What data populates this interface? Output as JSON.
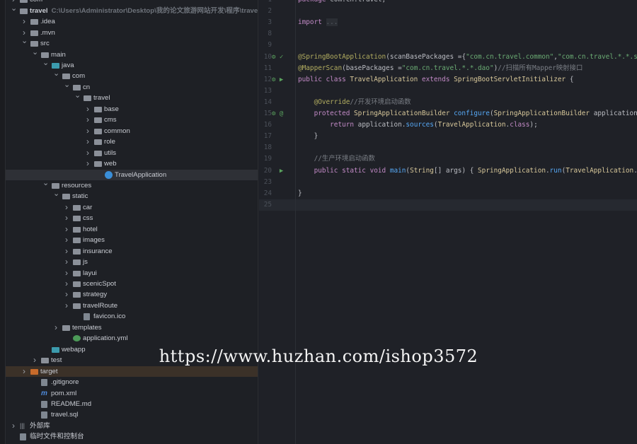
{
  "tree": [
    {
      "label": "com",
      "level": 0,
      "arrow": "right",
      "icon": "module"
    },
    {
      "label": "travel",
      "path": "C:\\Users\\Administrator\\Desktop\\我的论文旅游网站开发\\程序\\travel",
      "level": 0,
      "arrow": "down",
      "icon": "folder",
      "bold": true
    },
    {
      "label": ".idea",
      "level": 1,
      "arrow": "right",
      "icon": "folder"
    },
    {
      "label": ".mvn",
      "level": 1,
      "arrow": "right",
      "icon": "folder"
    },
    {
      "label": "src",
      "level": 1,
      "arrow": "down",
      "icon": "folder"
    },
    {
      "label": "main",
      "level": 2,
      "arrow": "down",
      "icon": "folder"
    },
    {
      "label": "java",
      "level": 3,
      "arrow": "down",
      "icon": "java"
    },
    {
      "label": "com",
      "level": 4,
      "arrow": "down",
      "icon": "package"
    },
    {
      "label": "cn",
      "level": 5,
      "arrow": "down",
      "icon": "package"
    },
    {
      "label": "travel",
      "level": 6,
      "arrow": "down",
      "icon": "package"
    },
    {
      "label": "base",
      "level": 7,
      "arrow": "right",
      "icon": "package"
    },
    {
      "label": "cms",
      "level": 7,
      "arrow": "right",
      "icon": "package"
    },
    {
      "label": "common",
      "level": 7,
      "arrow": "right",
      "icon": "package"
    },
    {
      "label": "role",
      "level": 7,
      "arrow": "right",
      "icon": "package"
    },
    {
      "label": "utils",
      "level": 7,
      "arrow": "right",
      "icon": "package"
    },
    {
      "label": "web",
      "level": 7,
      "arrow": "right",
      "icon": "package"
    },
    {
      "label": "TravelApplication",
      "level": 8,
      "icon": "class",
      "selected": true
    },
    {
      "label": "resources",
      "level": 3,
      "arrow": "down",
      "icon": "folder"
    },
    {
      "label": "static",
      "level": 4,
      "arrow": "down",
      "icon": "folder"
    },
    {
      "label": "car",
      "level": 5,
      "arrow": "right",
      "icon": "folder"
    },
    {
      "label": "css",
      "level": 5,
      "arrow": "right",
      "icon": "folder"
    },
    {
      "label": "hotel",
      "level": 5,
      "arrow": "right",
      "icon": "folder"
    },
    {
      "label": "images",
      "level": 5,
      "arrow": "right",
      "icon": "folder"
    },
    {
      "label": "insurance",
      "level": 5,
      "arrow": "right",
      "icon": "folder"
    },
    {
      "label": "js",
      "level": 5,
      "arrow": "right",
      "icon": "folder"
    },
    {
      "label": "layui",
      "level": 5,
      "arrow": "right",
      "icon": "folder"
    },
    {
      "label": "scenicSpot",
      "level": 5,
      "arrow": "right",
      "icon": "folder"
    },
    {
      "label": "strategy",
      "level": 5,
      "arrow": "right",
      "icon": "folder"
    },
    {
      "label": "travelRoute",
      "level": 5,
      "arrow": "right",
      "icon": "folder"
    },
    {
      "label": "favicon.ico",
      "level": 6,
      "icon": "file"
    },
    {
      "label": "templates",
      "level": 4,
      "arrow": "right",
      "icon": "folder"
    },
    {
      "label": "application.yml",
      "level": 5,
      "icon": "yml"
    },
    {
      "label": "webapp",
      "level": 3,
      "icon": "java"
    },
    {
      "label": "test",
      "level": 2,
      "arrow": "right",
      "icon": "folder"
    },
    {
      "label": "target",
      "level": 1,
      "arrow": "right",
      "icon": "orange",
      "target": true
    },
    {
      "label": ".gitignore",
      "level": 2,
      "icon": "file"
    },
    {
      "label": "pom.xml",
      "level": 2,
      "icon": "mvn"
    },
    {
      "label": "README.md",
      "level": 2,
      "icon": "file"
    },
    {
      "label": "travel.sql",
      "level": 2,
      "icon": "file"
    },
    {
      "label": "外部库",
      "level": 0,
      "arrow": "right",
      "icon": "lib"
    },
    {
      "label": "临时文件和控制台",
      "level": 0,
      "icon": "file"
    }
  ],
  "editor": {
    "lines": [
      {
        "n": "1",
        "t": [
          [
            "kw",
            "package "
          ],
          [
            "pl",
            "com.cn.travel;"
          ]
        ]
      },
      {
        "n": "2",
        "t": []
      },
      {
        "n": "3",
        "t": [
          [
            "kw",
            "import "
          ],
          [
            "fold",
            "..."
          ]
        ]
      },
      {
        "n": "8",
        "t": []
      },
      {
        "n": "9",
        "t": []
      },
      {
        "n": "10",
        "g": "⚙ ✓",
        "t": [
          [
            "an",
            "@SpringBootApplication"
          ],
          [
            "pl",
            "("
          ],
          [
            "pl",
            "scanBasePackages ="
          ],
          [
            "pl",
            "{"
          ],
          [
            "st",
            "\"com.cn.travel.common\""
          ],
          [
            "pl",
            ","
          ],
          [
            "st",
            "\"com.cn.travel.*.*.se"
          ]
        ]
      },
      {
        "n": "11",
        "t": [
          [
            "an",
            "@MapperScan"
          ],
          [
            "pl",
            "(basePackages ="
          ],
          [
            "st",
            "\"com.cn.travel.*.*.dao\""
          ],
          [
            "pl",
            ")"
          ],
          [
            "cm",
            "//扫描所有Mapper映射接口"
          ]
        ]
      },
      {
        "n": "12",
        "g": "⚙ ▶",
        "t": [
          [
            "kw",
            "public class "
          ],
          [
            "cl",
            "TravelApplication "
          ],
          [
            "kw",
            "extends "
          ],
          [
            "cl",
            "SpringBootServletInitializer "
          ],
          [
            "pl",
            "{"
          ]
        ]
      },
      {
        "n": "13",
        "t": []
      },
      {
        "n": "14",
        "t": [
          [
            "pl",
            "    "
          ],
          [
            "an",
            "@Override"
          ],
          [
            "cm",
            "//开发环境启动函数"
          ]
        ]
      },
      {
        "n": "15",
        "g": "⚙ @",
        "t": [
          [
            "pl",
            "    "
          ],
          [
            "kw",
            "protected "
          ],
          [
            "cl",
            "SpringApplicationBuilder "
          ],
          [
            "fn",
            "configure"
          ],
          [
            "pl",
            "("
          ],
          [
            "cl",
            "SpringApplicationBuilder "
          ],
          [
            "pl",
            "application)"
          ]
        ]
      },
      {
        "n": "16",
        "t": [
          [
            "pl",
            "        "
          ],
          [
            "kw",
            "return "
          ],
          [
            "pl",
            "application."
          ],
          [
            "fn",
            "sources"
          ],
          [
            "pl",
            "("
          ],
          [
            "cl",
            "TravelApplication"
          ],
          [
            "pl",
            "."
          ],
          [
            "kw",
            "class"
          ],
          [
            "pl",
            ");"
          ]
        ]
      },
      {
        "n": "17",
        "t": [
          [
            "pl",
            "    }"
          ]
        ]
      },
      {
        "n": "18",
        "t": []
      },
      {
        "n": "19",
        "t": [
          [
            "pl",
            "    "
          ],
          [
            "cm",
            "//生产环境启动函数"
          ]
        ]
      },
      {
        "n": "20",
        "g": "  ▶",
        "t": [
          [
            "pl",
            "    "
          ],
          [
            "kw",
            "public static void "
          ],
          [
            "fn",
            "main"
          ],
          [
            "pl",
            "("
          ],
          [
            "cl",
            "String"
          ],
          [
            "pl",
            "[] "
          ],
          [
            "pl",
            "args) { "
          ],
          [
            "cl",
            "SpringApplication"
          ],
          [
            "pl",
            "."
          ],
          [
            "fn",
            "run"
          ],
          [
            "pl",
            "("
          ],
          [
            "cl",
            "TravelApplication"
          ],
          [
            "pl",
            ".c"
          ]
        ]
      },
      {
        "n": "23",
        "t": []
      },
      {
        "n": "24",
        "t": [
          [
            "pl",
            "}"
          ]
        ]
      },
      {
        "n": "25",
        "t": [],
        "current": true
      }
    ]
  },
  "watermark": "https://www.huzhan.com/ishop3572"
}
